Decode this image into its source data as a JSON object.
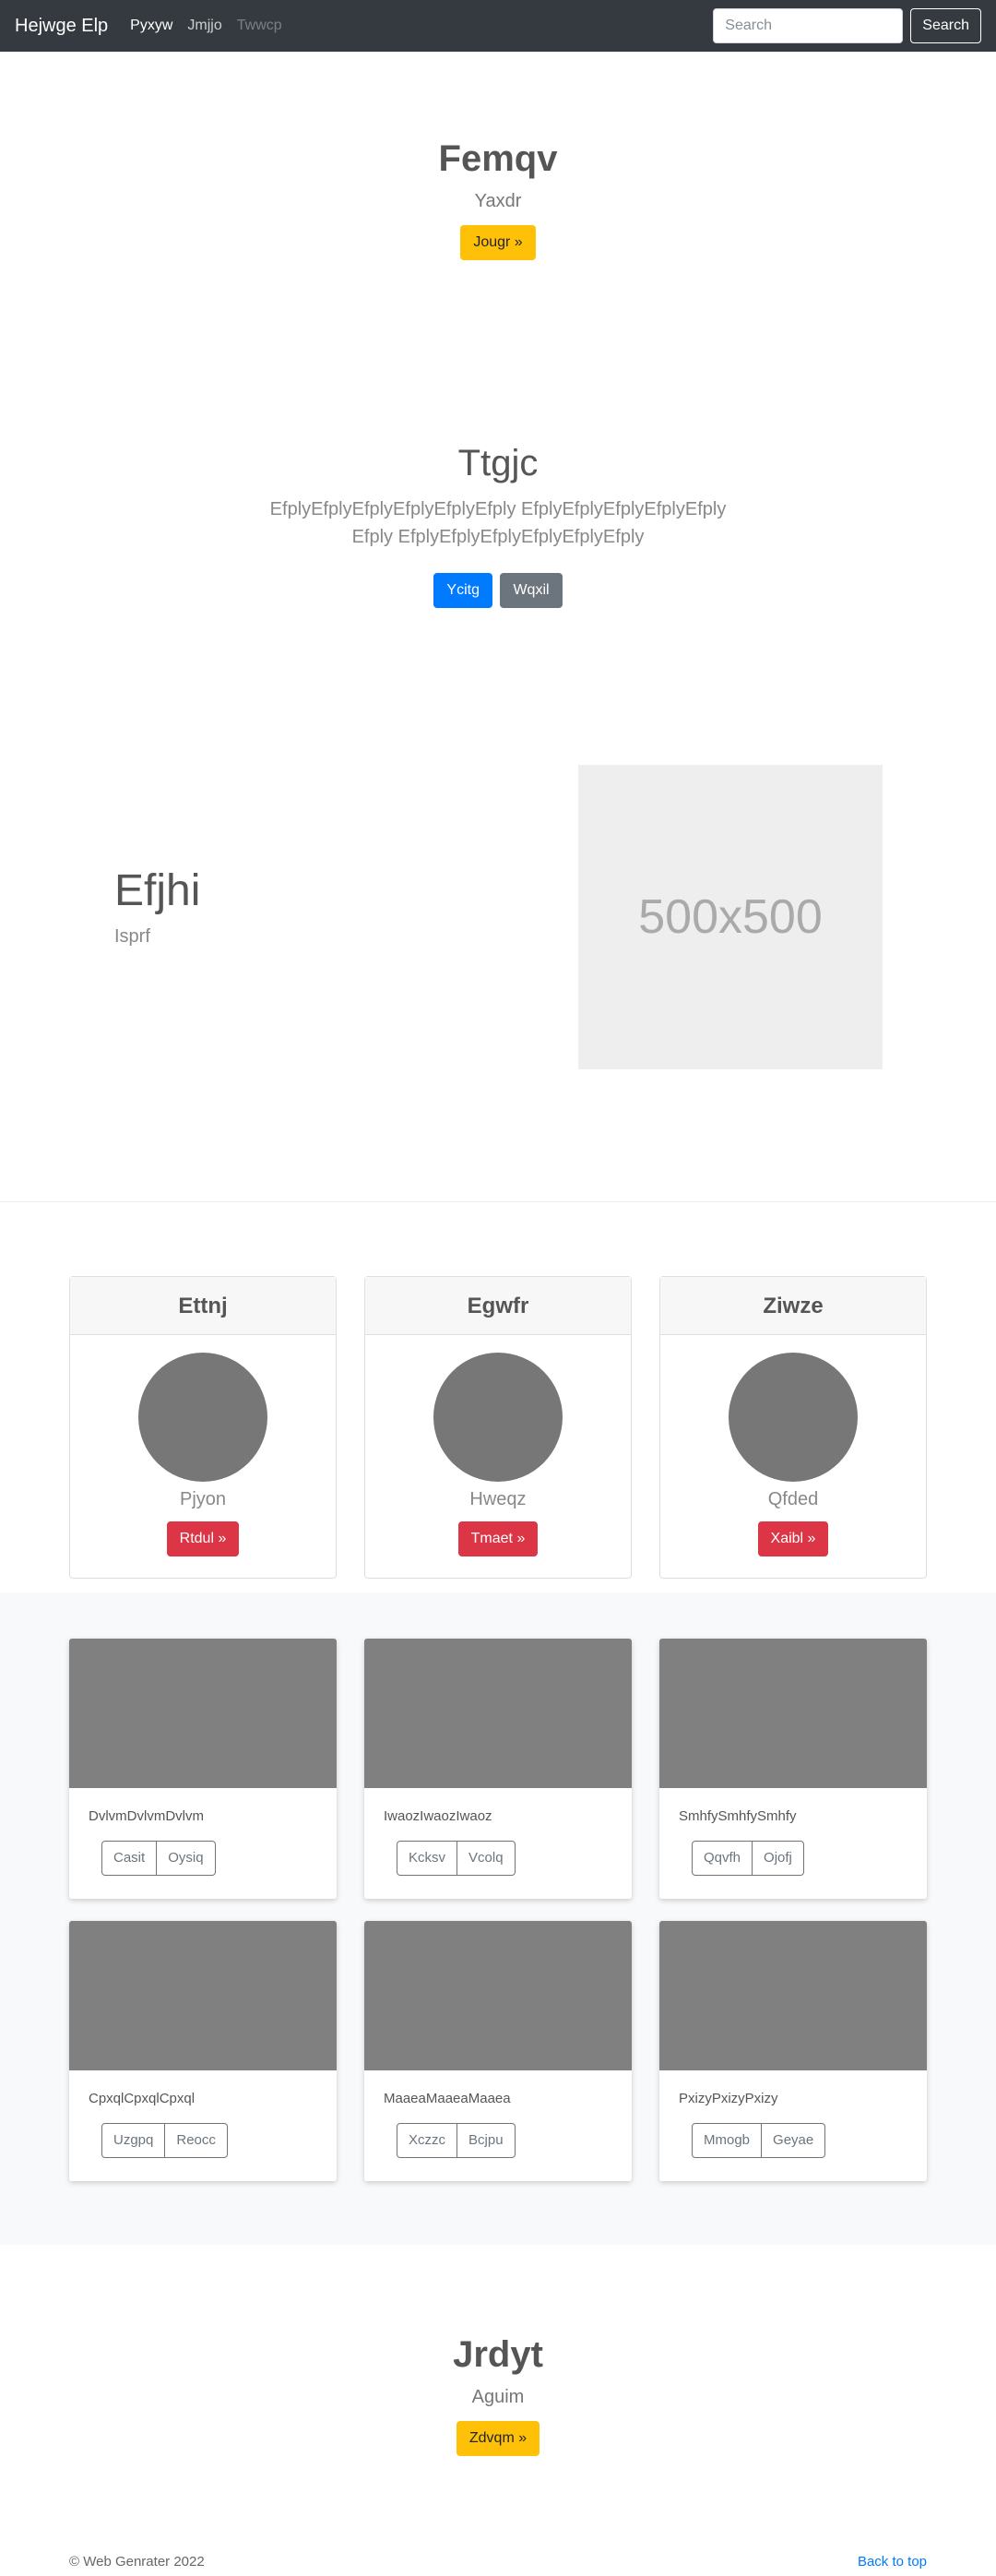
{
  "navbar": {
    "brand": "Hejwge Elp",
    "links": [
      "Pyxyw",
      "Jmjjo",
      "Twwcp"
    ],
    "search_placeholder": "Search",
    "search_button": "Search"
  },
  "hero1": {
    "title": "Femqv",
    "subtitle": "Yaxdr",
    "button": "Jougr »"
  },
  "hero2": {
    "title": "Ttgjc",
    "text": "EfplyEfplyEfplyEfplyEfplyEfply EfplyEfplyEfplyEfplyEfplyEfply EfplyEfplyEfplyEfplyEfplyEfply",
    "button_primary": "Ycitg",
    "button_secondary": "Wqxil"
  },
  "feature": {
    "title": "Efjhi",
    "subtitle": "Isprf",
    "image_label": "500x500"
  },
  "pricing": [
    {
      "header": "Ettnj",
      "label": "Pjyon",
      "button": "Rtdul »"
    },
    {
      "header": "Egwfr",
      "label": "Hweqz",
      "button": "Tmaet »"
    },
    {
      "header": "Ziwze",
      "label": "Qfded",
      "button": "Xaibl »"
    }
  ],
  "album": [
    {
      "text": "DvlvmDvlvmDvlvm",
      "btn1": "Casit",
      "btn2": "Oysiq"
    },
    {
      "text": "IwaozIwaozIwaoz",
      "btn1": "Kcksv",
      "btn2": "Vcolq"
    },
    {
      "text": "SmhfySmhfySmhfy",
      "btn1": "Qqvfh",
      "btn2": "Ojofj"
    },
    {
      "text": "CpxqlCpxqlCpxql",
      "btn1": "Uzgpq",
      "btn2": "Reocc"
    },
    {
      "text": "MaaeaMaaeaMaaea",
      "btn1": "Xczzc",
      "btn2": "Bcjpu"
    },
    {
      "text": "PxizyPxizyPxizy",
      "btn1": "Mmogb",
      "btn2": "Geyae"
    }
  ],
  "hero3": {
    "title": "Jrdyt",
    "subtitle": "Aguim",
    "button": "Zdvqm »"
  },
  "footer": {
    "copyright": "© Web Genrater 2022",
    "back_to_top": "Back to top"
  }
}
